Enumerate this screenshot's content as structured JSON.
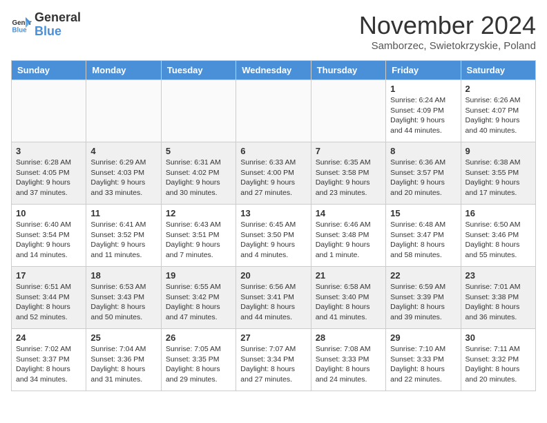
{
  "header": {
    "logo_general": "General",
    "logo_blue": "Blue",
    "month_title": "November 2024",
    "location": "Samborzec, Swietokrzyskie, Poland"
  },
  "days_of_week": [
    "Sunday",
    "Monday",
    "Tuesday",
    "Wednesday",
    "Thursday",
    "Friday",
    "Saturday"
  ],
  "weeks": [
    [
      {
        "day": "",
        "info": ""
      },
      {
        "day": "",
        "info": ""
      },
      {
        "day": "",
        "info": ""
      },
      {
        "day": "",
        "info": ""
      },
      {
        "day": "",
        "info": ""
      },
      {
        "day": "1",
        "info": "Sunrise: 6:24 AM\nSunset: 4:09 PM\nDaylight: 9 hours and 44 minutes."
      },
      {
        "day": "2",
        "info": "Sunrise: 6:26 AM\nSunset: 4:07 PM\nDaylight: 9 hours and 40 minutes."
      }
    ],
    [
      {
        "day": "3",
        "info": "Sunrise: 6:28 AM\nSunset: 4:05 PM\nDaylight: 9 hours and 37 minutes."
      },
      {
        "day": "4",
        "info": "Sunrise: 6:29 AM\nSunset: 4:03 PM\nDaylight: 9 hours and 33 minutes."
      },
      {
        "day": "5",
        "info": "Sunrise: 6:31 AM\nSunset: 4:02 PM\nDaylight: 9 hours and 30 minutes."
      },
      {
        "day": "6",
        "info": "Sunrise: 6:33 AM\nSunset: 4:00 PM\nDaylight: 9 hours and 27 minutes."
      },
      {
        "day": "7",
        "info": "Sunrise: 6:35 AM\nSunset: 3:58 PM\nDaylight: 9 hours and 23 minutes."
      },
      {
        "day": "8",
        "info": "Sunrise: 6:36 AM\nSunset: 3:57 PM\nDaylight: 9 hours and 20 minutes."
      },
      {
        "day": "9",
        "info": "Sunrise: 6:38 AM\nSunset: 3:55 PM\nDaylight: 9 hours and 17 minutes."
      }
    ],
    [
      {
        "day": "10",
        "info": "Sunrise: 6:40 AM\nSunset: 3:54 PM\nDaylight: 9 hours and 14 minutes."
      },
      {
        "day": "11",
        "info": "Sunrise: 6:41 AM\nSunset: 3:52 PM\nDaylight: 9 hours and 11 minutes."
      },
      {
        "day": "12",
        "info": "Sunrise: 6:43 AM\nSunset: 3:51 PM\nDaylight: 9 hours and 7 minutes."
      },
      {
        "day": "13",
        "info": "Sunrise: 6:45 AM\nSunset: 3:50 PM\nDaylight: 9 hours and 4 minutes."
      },
      {
        "day": "14",
        "info": "Sunrise: 6:46 AM\nSunset: 3:48 PM\nDaylight: 9 hours and 1 minute."
      },
      {
        "day": "15",
        "info": "Sunrise: 6:48 AM\nSunset: 3:47 PM\nDaylight: 8 hours and 58 minutes."
      },
      {
        "day": "16",
        "info": "Sunrise: 6:50 AM\nSunset: 3:46 PM\nDaylight: 8 hours and 55 minutes."
      }
    ],
    [
      {
        "day": "17",
        "info": "Sunrise: 6:51 AM\nSunset: 3:44 PM\nDaylight: 8 hours and 52 minutes."
      },
      {
        "day": "18",
        "info": "Sunrise: 6:53 AM\nSunset: 3:43 PM\nDaylight: 8 hours and 50 minutes."
      },
      {
        "day": "19",
        "info": "Sunrise: 6:55 AM\nSunset: 3:42 PM\nDaylight: 8 hours and 47 minutes."
      },
      {
        "day": "20",
        "info": "Sunrise: 6:56 AM\nSunset: 3:41 PM\nDaylight: 8 hours and 44 minutes."
      },
      {
        "day": "21",
        "info": "Sunrise: 6:58 AM\nSunset: 3:40 PM\nDaylight: 8 hours and 41 minutes."
      },
      {
        "day": "22",
        "info": "Sunrise: 6:59 AM\nSunset: 3:39 PM\nDaylight: 8 hours and 39 minutes."
      },
      {
        "day": "23",
        "info": "Sunrise: 7:01 AM\nSunset: 3:38 PM\nDaylight: 8 hours and 36 minutes."
      }
    ],
    [
      {
        "day": "24",
        "info": "Sunrise: 7:02 AM\nSunset: 3:37 PM\nDaylight: 8 hours and 34 minutes."
      },
      {
        "day": "25",
        "info": "Sunrise: 7:04 AM\nSunset: 3:36 PM\nDaylight: 8 hours and 31 minutes."
      },
      {
        "day": "26",
        "info": "Sunrise: 7:05 AM\nSunset: 3:35 PM\nDaylight: 8 hours and 29 minutes."
      },
      {
        "day": "27",
        "info": "Sunrise: 7:07 AM\nSunset: 3:34 PM\nDaylight: 8 hours and 27 minutes."
      },
      {
        "day": "28",
        "info": "Sunrise: 7:08 AM\nSunset: 3:33 PM\nDaylight: 8 hours and 24 minutes."
      },
      {
        "day": "29",
        "info": "Sunrise: 7:10 AM\nSunset: 3:33 PM\nDaylight: 8 hours and 22 minutes."
      },
      {
        "day": "30",
        "info": "Sunrise: 7:11 AM\nSunset: 3:32 PM\nDaylight: 8 hours and 20 minutes."
      }
    ]
  ]
}
